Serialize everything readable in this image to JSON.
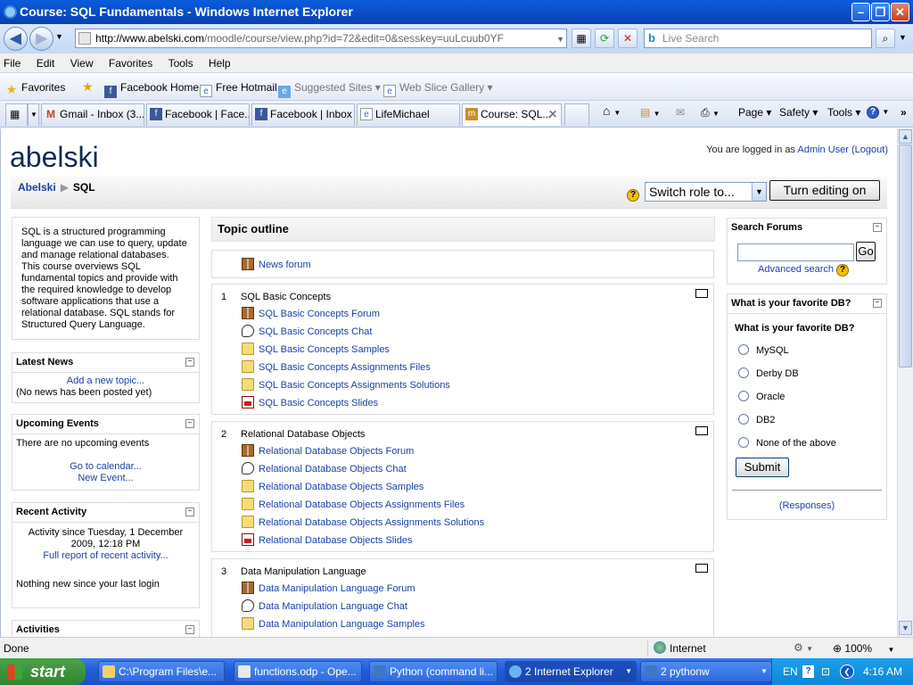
{
  "window": {
    "title": "Course: SQL Fundamentals - Windows Internet Explorer"
  },
  "nav": {
    "address_host": "http://www.abelski.com",
    "address_path": "/moodle/course/view.php?id=72&edit=0&sesskey=uuLcuub0YF",
    "live_search_placeholder": "Live Search"
  },
  "menu": [
    "File",
    "Edit",
    "View",
    "Favorites",
    "Tools",
    "Help"
  ],
  "favorites_bar": {
    "favorites_label": "Favorites",
    "items": [
      "Facebook Home",
      "Free Hotmail",
      "Suggested Sites ▾",
      "Web Slice Gallery ▾"
    ]
  },
  "tabs": [
    "Gmail - Inbox (3...",
    "Facebook | Face...",
    "Facebook | Inbox",
    "LifeMichael",
    "Course: SQL..."
  ],
  "commands": {
    "page": "Page ▾",
    "safety": "Safety ▾",
    "tools": "Tools ▾"
  },
  "site": {
    "title": "abelski",
    "login_prefix": "You are logged in as",
    "login_user": "Admin User",
    "logout": "(Logout)",
    "crumb_home": "Abelski",
    "crumb_current": "SQL",
    "switch_role": "Switch role to...",
    "turn_editing": "Turn editing on"
  },
  "left": {
    "summary": "SQL is a structured programming language we can use to query, update and manage relational databases. This course overviews SQL fundamental topics and provide with the required knowledge to develop software applications that use a relational database. SQL stands for Structured Query Language.",
    "latest_news": {
      "title": "Latest News",
      "add": "Add a new topic...",
      "none": "(No news has been posted yet)"
    },
    "upcoming": {
      "title": "Upcoming Events",
      "none": "There are no upcoming events",
      "calendar": "Go to calendar...",
      "new_event": "New Event..."
    },
    "recent": {
      "title": "Recent Activity",
      "since": "Activity since Tuesday, 1 December 2009, 12:18 PM",
      "full": "Full report of recent activity...",
      "nothing": "Nothing new since your last login"
    },
    "activities": {
      "title": "Activities"
    }
  },
  "topics": {
    "outline_title": "Topic outline",
    "news_forum": "News forum",
    "sections": [
      {
        "num": "1",
        "title": "SQL Basic Concepts",
        "items": [
          "SQL Basic Concepts Forum",
          "SQL Basic Concepts Chat",
          "SQL Basic Concepts Samples",
          "SQL Basic Concepts Assignments Files",
          "SQL Basic Concepts Assignments Solutions",
          "SQL Basic Concepts Slides"
        ]
      },
      {
        "num": "2",
        "title": "Relational Database Objects",
        "items": [
          "Relational Database Objects Forum",
          "Relational Database Objects Chat",
          "Relational Database Objects Samples",
          "Relational Database Objects Assignments Files",
          "Relational Database Objects Assignments Solutions",
          "Relational Database Objects Slides"
        ]
      },
      {
        "num": "3",
        "title": "Data Manipulation Language",
        "items": [
          "Data Manipulation Language Forum",
          "Data Manipulation Language Chat",
          "Data Manipulation Language Samples"
        ]
      }
    ]
  },
  "right": {
    "search": {
      "title": "Search Forums",
      "go": "Go",
      "advanced": "Advanced search"
    },
    "poll": {
      "title": "What is your favorite DB?",
      "question": "What is your favorite DB?",
      "options": [
        "MySQL",
        "Derby DB",
        "Oracle",
        "DB2",
        "None of the above"
      ],
      "submit": "Submit",
      "responses": "(Responses)"
    }
  },
  "status": {
    "text": "Done",
    "zone": "Internet",
    "zoom": "100%"
  },
  "taskbar": {
    "start": "start",
    "items": [
      "C:\\Program Files\\e...",
      "functions.odp - Ope...",
      "Python (command li...",
      "2 Internet Explorer",
      "2 pythonw"
    ],
    "lang": "EN",
    "clock": "4:16 AM"
  }
}
